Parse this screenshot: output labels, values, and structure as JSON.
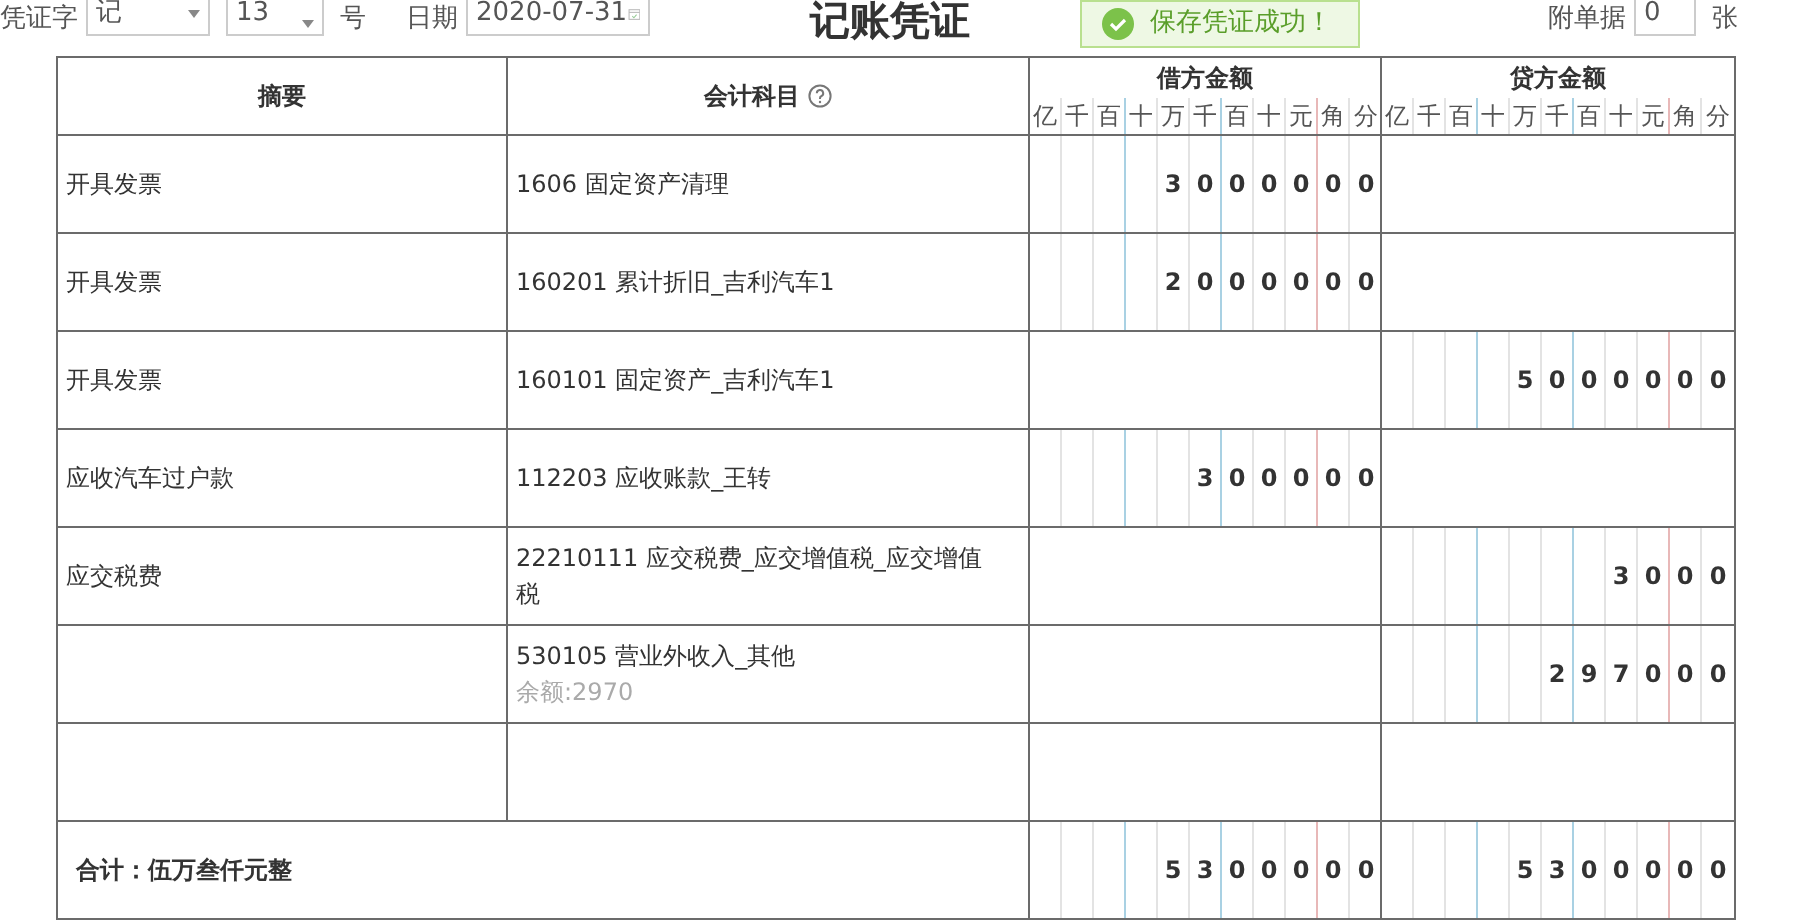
{
  "header": {
    "voucher_word_label": "凭证字",
    "voucher_word": "记",
    "number": "13",
    "number_suffix": "号",
    "date_label": "日期",
    "date": "2020-07-31",
    "title": "记账凭证",
    "attachments_label": "附单据",
    "attachments": "0",
    "attachments_unit": "张"
  },
  "toast": {
    "message": "保存凭证成功！"
  },
  "table": {
    "columns": [
      "摘要",
      "会计科目"
    ],
    "debit_heading": "借方金额",
    "credit_heading": "贷方金额",
    "debit_units": [
      "亿",
      "千",
      "百",
      "十",
      "万",
      "千",
      "百",
      "十",
      "元",
      "角",
      "分"
    ],
    "credit_units": [
      "亿",
      "千",
      "百",
      "十",
      "万",
      "千",
      "百",
      "十",
      "元",
      "角",
      "分"
    ],
    "rows": [
      {
        "summary": "开具发票",
        "account": "1606 固定资产清理",
        "debit": [
          "3",
          "0",
          "0",
          "0",
          "0",
          "0",
          "0"
        ]
      },
      {
        "summary": "开具发票",
        "account": "160201 累计折旧_吉利汽车1",
        "debit": [
          "2",
          "0",
          "0",
          "0",
          "0",
          "0",
          "0"
        ]
      },
      {
        "summary": "开具发票",
        "account": "160101 固定资产_吉利汽车1",
        "credit": [
          "5",
          "0",
          "0",
          "0",
          "0",
          "0",
          "0"
        ]
      },
      {
        "summary": "应收汽车过户款",
        "account": "112203 应收账款_王转",
        "debit": [
          "3",
          "0",
          "0",
          "0",
          "0",
          "0"
        ]
      },
      {
        "summary": "应交税费",
        "account": "22210111 应交税费_应交增值税_应交增值税",
        "credit": [
          "3",
          "0",
          "0",
          "0"
        ]
      },
      {
        "account": "530105 营业外收入_其他",
        "balance": "余额:2970",
        "credit": [
          "2",
          "9",
          "7",
          "0",
          "0",
          "0"
        ]
      },
      {}
    ],
    "total": {
      "label": "合计：伍万叁仟元整",
      "debit": [
        "5",
        "3",
        "0",
        "0",
        "0",
        "0",
        "0"
      ],
      "credit": [
        "5",
        "3",
        "0",
        "0",
        "0",
        "0",
        "0"
      ]
    }
  }
}
